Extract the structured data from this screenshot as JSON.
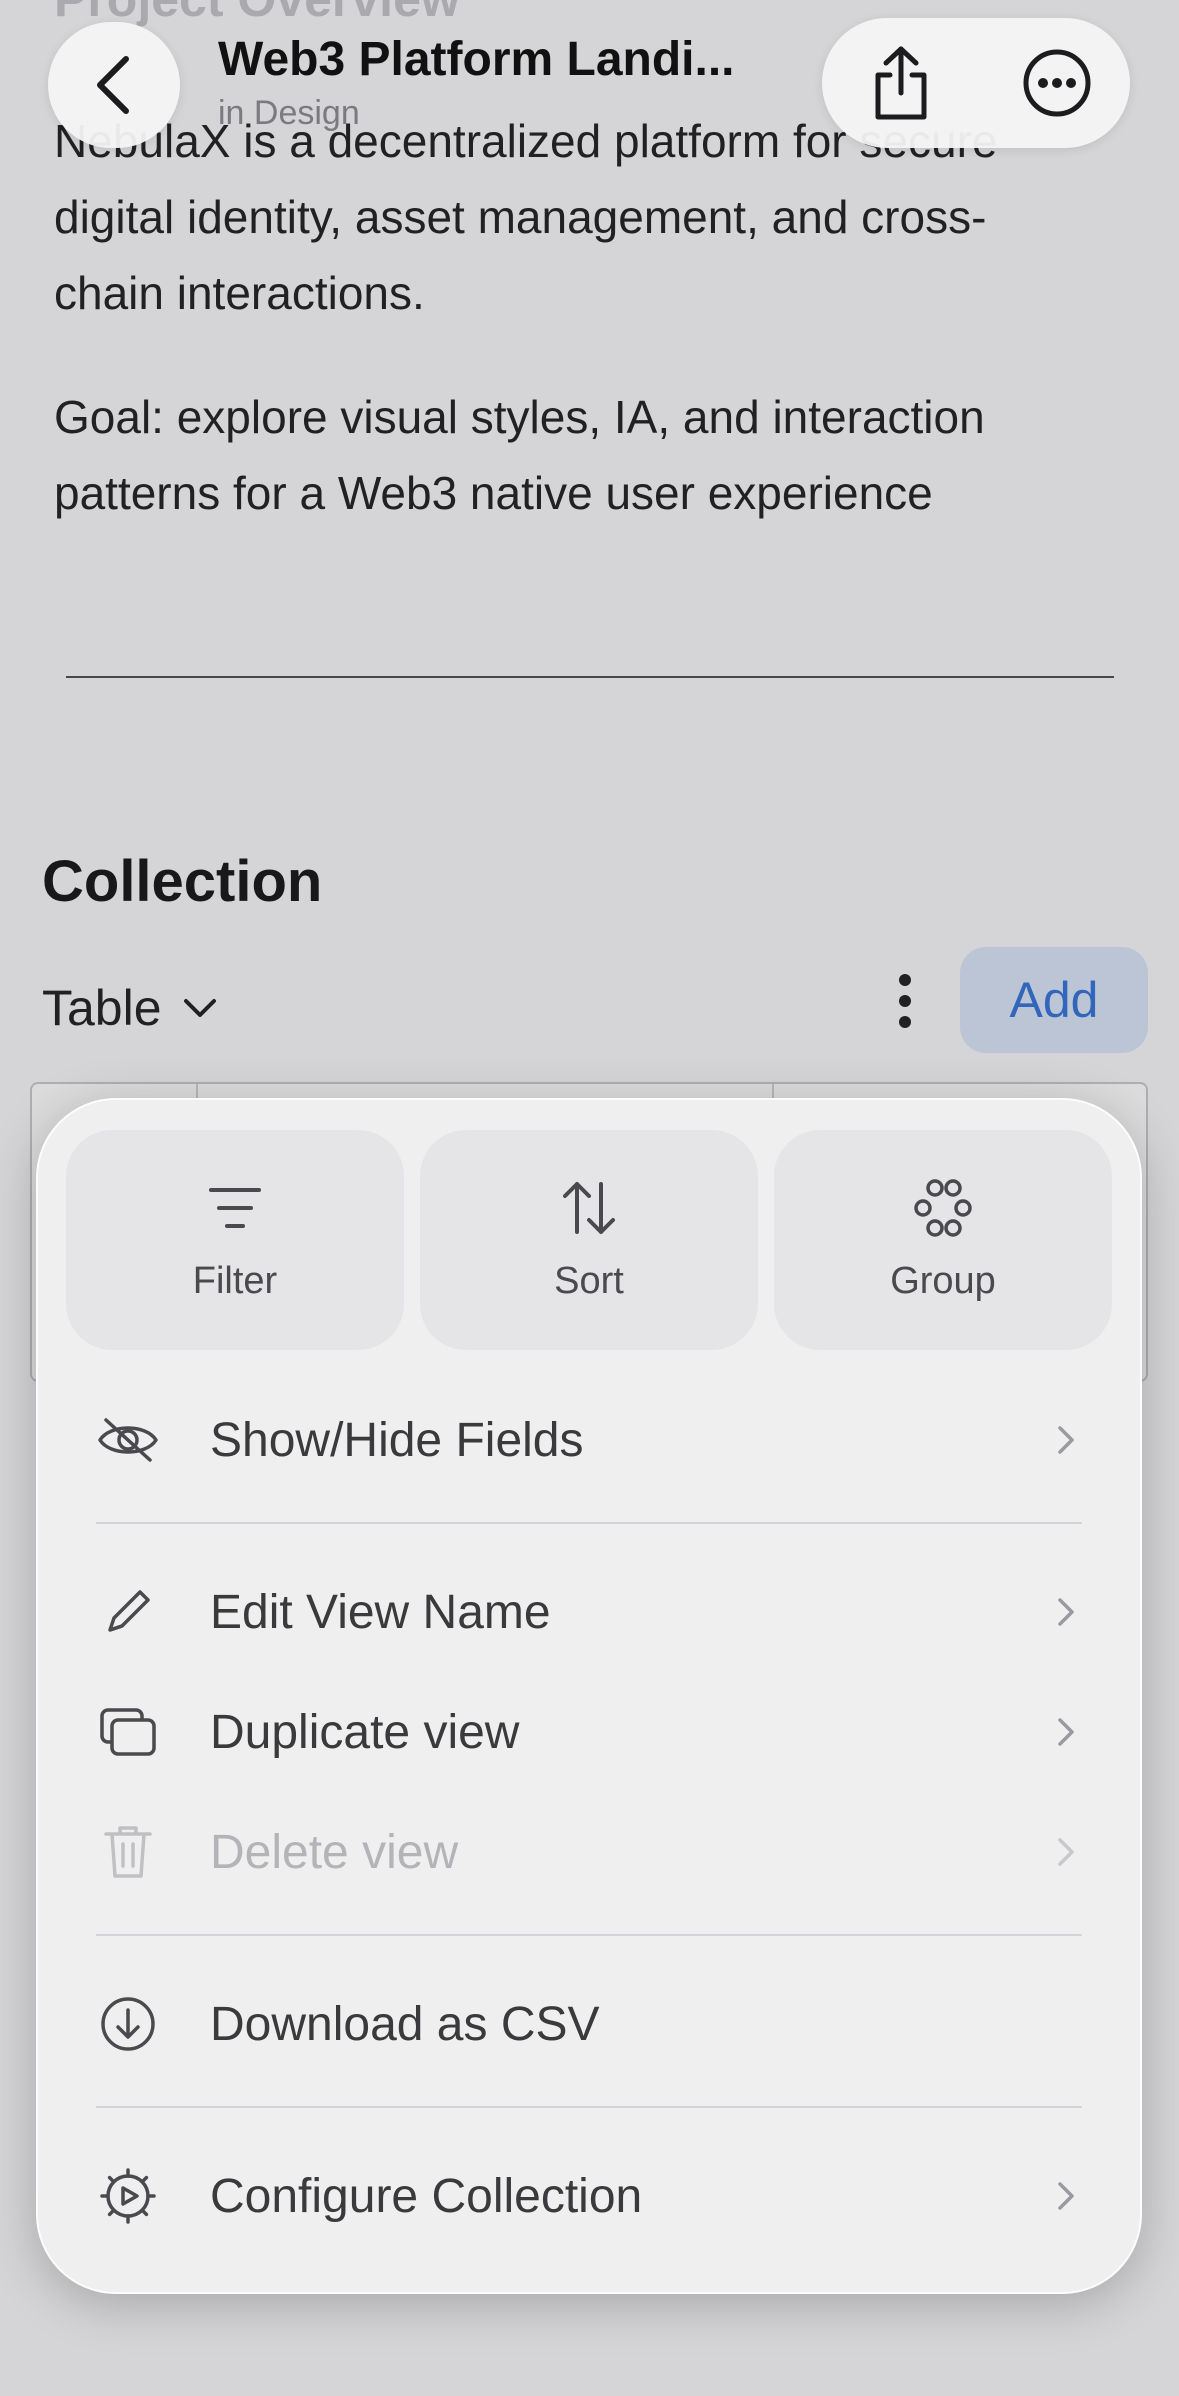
{
  "nav": {
    "title": "Web3 Platform Landi...",
    "subtitle": "in Design"
  },
  "document": {
    "ghost_heading": "Project Overview",
    "paragraph_1": "NebulaX is a decentralized platform for secure digital identity, asset management, and cross-chain interactions.",
    "paragraph_2": "Goal: explore visual styles, IA, and interaction patterns for a Web3 native user experience"
  },
  "collection": {
    "title": "Collection",
    "view_label": "Table",
    "add_label": "Add"
  },
  "menu": {
    "tiles": [
      {
        "label": "Filter",
        "icon": "filter-icon"
      },
      {
        "label": "Sort",
        "icon": "sort-icon"
      },
      {
        "label": "Group",
        "icon": "group-icon"
      }
    ],
    "items": [
      {
        "label": "Show/Hide Fields",
        "icon": "eye-slash-icon",
        "chevron": true,
        "disabled": false
      },
      {
        "label": "Edit View Name",
        "icon": "pencil-icon",
        "chevron": true,
        "disabled": false
      },
      {
        "label": "Duplicate view",
        "icon": "duplicate-icon",
        "chevron": true,
        "disabled": false
      },
      {
        "label": "Delete view",
        "icon": "trash-icon",
        "chevron": true,
        "disabled": true
      },
      {
        "label": "Download as CSV",
        "icon": "download-icon",
        "chevron": false,
        "disabled": false
      },
      {
        "label": "Configure Collection",
        "icon": "gear-icon",
        "chevron": true,
        "disabled": false
      }
    ]
  },
  "colors": {
    "accent": "#2f6fd6",
    "add_button_bg": "#d7e3f7",
    "disabled_text": "#b4b4b8"
  }
}
